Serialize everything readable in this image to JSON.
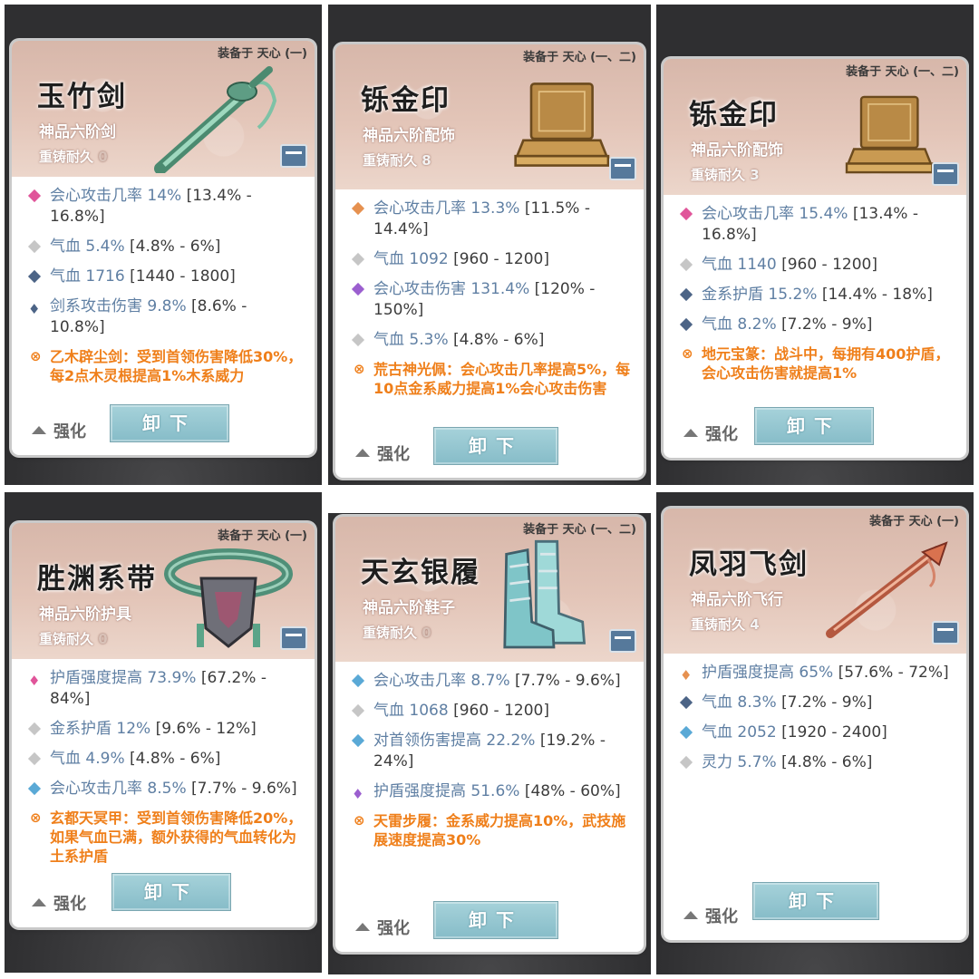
{
  "colors": {
    "stat_label": "#5f7fa3",
    "special_text": "#ef7f1a",
    "gem_pink": "#e0559a",
    "gem_gray": "#c6c6c6",
    "gem_navy": "#4c6486",
    "gem_blue": "#5aa9d6",
    "gem_orange": "#e69150",
    "gem_purple": "#9b5fcf",
    "button_bg": "#94c6d2"
  },
  "cards": [
    {
      "equip_label": "装备于 天心 (一)",
      "name": "玉竹剑",
      "grade": "神品六阶剑",
      "durability_label": "重铸耐久",
      "durability_value": "0",
      "art_icon": "jade-sword-icon",
      "stats": [
        {
          "icon": "pink-gem-icon",
          "label": "会心攻击几率 14%",
          "range": "[13.4% - 16.8%]"
        },
        {
          "icon": "gray-gem-icon",
          "label": "气血 5.4%",
          "range": "[4.8% - 6%]"
        },
        {
          "icon": "navy-gem-icon",
          "label": "气血 1716",
          "range": "[1440 - 1800]"
        },
        {
          "icon": "blue-flame-icon",
          "label": "剑系攻击伤害 9.8%",
          "range": "[8.6% - 10.8%]"
        }
      ],
      "special": "乙木辟尘剑：受到首领伤害降低30%，每2点木灵根提高1%木系威力",
      "enhance_label": "强化",
      "unload_label": "卸下"
    },
    {
      "equip_label": "装备于 天心 (一、二)",
      "name": "铄金印",
      "grade": "神品六阶配饰",
      "durability_label": "重铸耐久",
      "durability_value": "8",
      "art_icon": "golden-seal-icon",
      "stats": [
        {
          "icon": "orange-gem-icon",
          "label": "会心攻击几率 13.3%",
          "range": "[11.5% - 14.4%]"
        },
        {
          "icon": "gray-gem-icon",
          "label": "气血 1092",
          "range": "[960 - 1200]"
        },
        {
          "icon": "purple-gem-icon",
          "label": "会心攻击伤害 131.4%",
          "range": "[120% - 150%]"
        },
        {
          "icon": "gray-gem-icon",
          "label": "气血 5.3%",
          "range": "[4.8% - 6%]"
        }
      ],
      "special": "荒古神光佩：会心攻击几率提高5%，每10点金系威力提高1%会心攻击伤害",
      "enhance_label": "强化",
      "unload_label": "卸下"
    },
    {
      "equip_label": "装备于 天心 (一、二)",
      "name": "铄金印",
      "grade": "神品六阶配饰",
      "durability_label": "重铸耐久",
      "durability_value": "3",
      "art_icon": "golden-seal-icon",
      "stats": [
        {
          "icon": "pink-gem-icon",
          "label": "会心攻击几率 15.4%",
          "range": "[13.4% - 16.8%]"
        },
        {
          "icon": "gray-gem-icon",
          "label": "气血 1140",
          "range": "[960 - 1200]"
        },
        {
          "icon": "navy-gem-icon",
          "label": "金系护盾 15.2%",
          "range": "[14.4% - 18%]"
        },
        {
          "icon": "navy-gem-icon",
          "label": "气血 8.2%",
          "range": "[7.2% - 9%]"
        }
      ],
      "special": "地元宝篆：战斗中，每拥有400护盾，会心攻击伤害就提高1%",
      "enhance_label": "强化",
      "unload_label": "卸下"
    },
    {
      "equip_label": "装备于 天心 (一)",
      "name": "胜渊系带",
      "grade": "神品六阶护具",
      "durability_label": "重铸耐久",
      "durability_value": "0",
      "art_icon": "jade-belt-icon",
      "stats": [
        {
          "icon": "pink-flame-icon",
          "label": "护盾强度提高 73.9%",
          "range": "[67.2% - 84%]"
        },
        {
          "icon": "gray-gem-icon",
          "label": "金系护盾 12%",
          "range": "[9.6% - 12%]"
        },
        {
          "icon": "gray-gem-icon",
          "label": "气血 4.9%",
          "range": "[4.8% - 6%]"
        },
        {
          "icon": "blue-gem-icon",
          "label": "会心攻击几率 8.5%",
          "range": "[7.7% - 9.6%]"
        }
      ],
      "special": "玄都天冥甲：受到首领伤害降低20%，如果气血已满，额外获得的气血转化为土系护盾",
      "enhance_label": "强化",
      "unload_label": "卸下"
    },
    {
      "equip_label": "装备于 天心 (一、二)",
      "name": "天玄银履",
      "grade": "神品六阶鞋子",
      "durability_label": "重铸耐久",
      "durability_value": "0",
      "art_icon": "silver-boots-icon",
      "stats": [
        {
          "icon": "blue-gem-icon",
          "label": "会心攻击几率 8.7%",
          "range": "[7.7% - 9.6%]"
        },
        {
          "icon": "gray-gem-icon",
          "label": "气血 1068",
          "range": "[960 - 1200]"
        },
        {
          "icon": "blue-gem-icon",
          "label": "对首领伤害提高 22.2%",
          "range": "[19.2% - 24%]"
        },
        {
          "icon": "purple-flame-icon",
          "label": "护盾强度提高 51.6%",
          "range": "[48% - 60%]"
        }
      ],
      "special": "天雷步履：金系威力提高10%，武技施展速度提高30%",
      "enhance_label": "强化",
      "unload_label": "卸下"
    },
    {
      "equip_label": "装备于 天心 (一)",
      "name": "凤羽飞剑",
      "grade": "神品六阶飞行",
      "durability_label": "重铸耐久",
      "durability_value": "4",
      "art_icon": "phoenix-flying-sword-icon",
      "stats": [
        {
          "icon": "orange-flame-icon",
          "label": "护盾强度提高 65%",
          "range": "[57.6% - 72%]"
        },
        {
          "icon": "navy-gem-icon",
          "label": "气血 8.3%",
          "range": "[7.2% - 9%]"
        },
        {
          "icon": "blue-gem-icon",
          "label": "气血 2052",
          "range": "[1920 - 2400]"
        },
        {
          "icon": "gray-gem-icon",
          "label": "灵力 5.7%",
          "range": "[4.8% - 6%]"
        }
      ],
      "special": "",
      "enhance_label": "强化",
      "unload_label": "卸下"
    }
  ]
}
